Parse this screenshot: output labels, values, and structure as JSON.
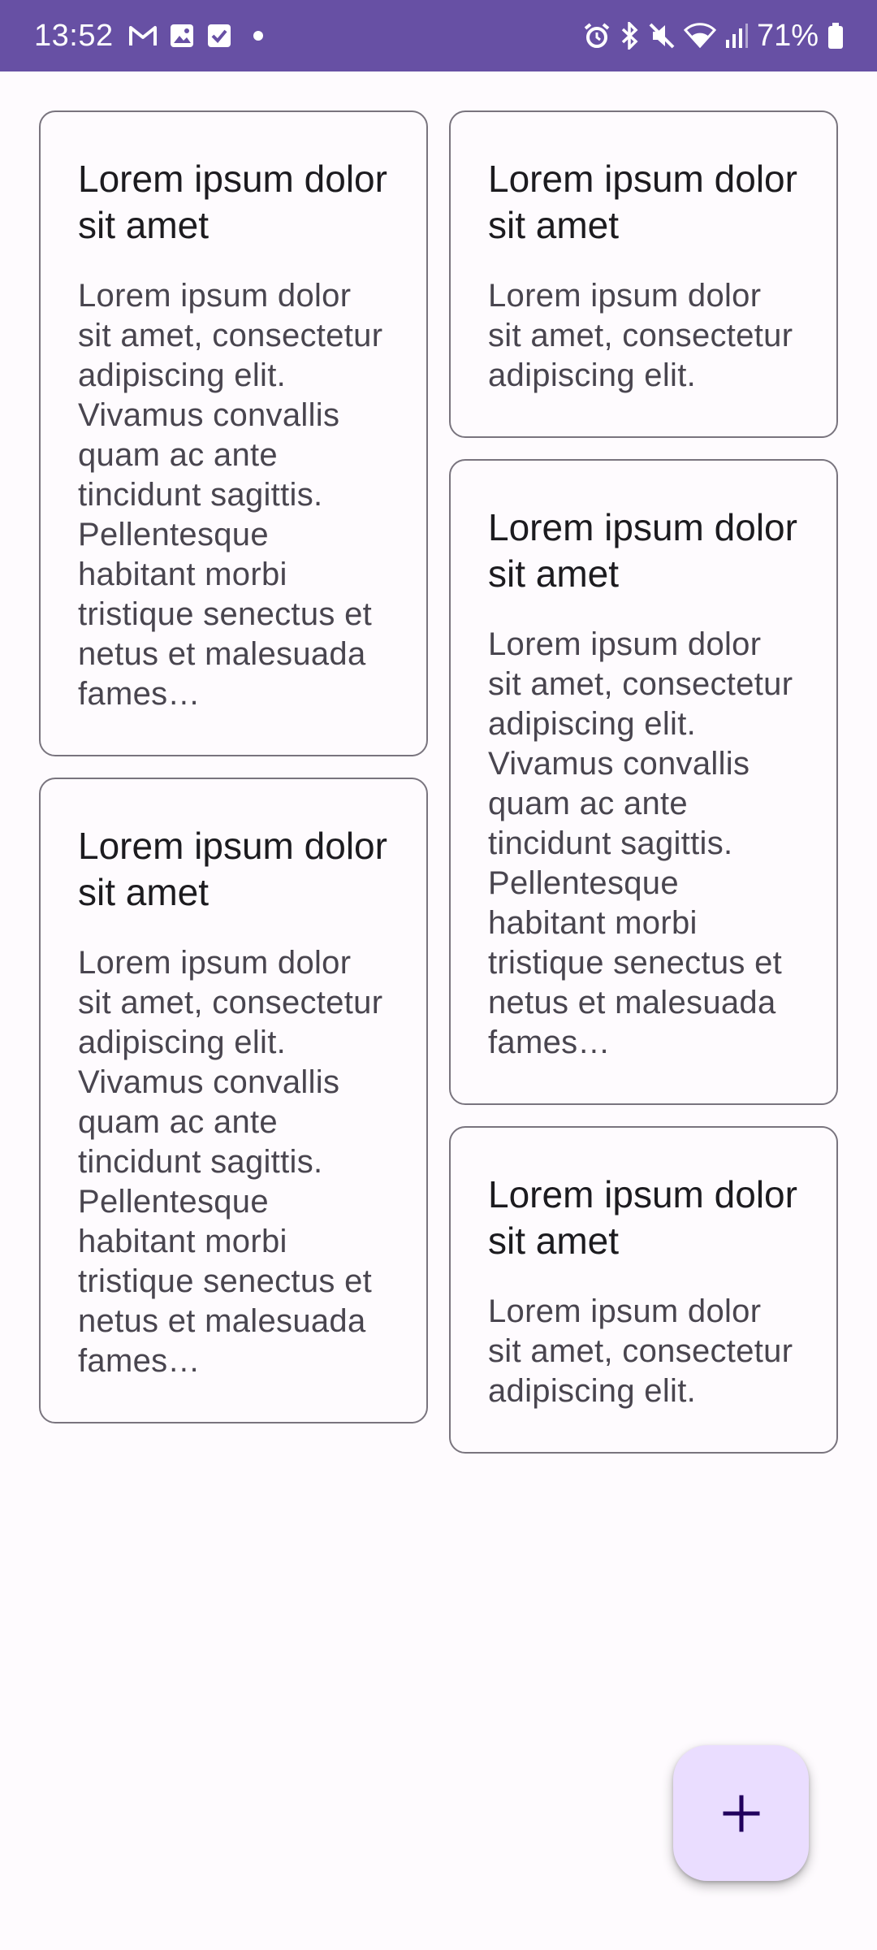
{
  "status_bar": {
    "time": "13:52",
    "battery": "71%",
    "left_icons": [
      "gmail-icon",
      "gallery-icon",
      "checkbox-icon",
      "dot-icon"
    ],
    "right_icons": [
      "alarm-icon",
      "bluetooth-icon",
      "mute-icon",
      "wifi-icon",
      "signal-icon",
      "battery-icon"
    ],
    "background_color": "#6750a4"
  },
  "notes": {
    "left_column": [
      {
        "title": "Lorem ipsum dolor sit amet",
        "body": "Lorem ipsum dolor sit amet, consectetur adipiscing elit. Vivamus convallis quam ac ante tincidunt sagittis. Pellentesque habitant morbi tristique senectus et netus et malesuada fames…"
      },
      {
        "title": "Lorem ipsum dolor sit amet",
        "body": "Lorem ipsum dolor sit amet, consectetur adipiscing elit. Vivamus convallis quam ac ante tincidunt sagittis. Pellentesque habitant morbi tristique senectus et netus et malesuada fames…"
      }
    ],
    "right_column": [
      {
        "title": "Lorem ipsum dolor sit amet",
        "body": "Lorem ipsum dolor sit amet, consectetur adipiscing elit."
      },
      {
        "title": "Lorem ipsum dolor sit amet",
        "body": "Lorem ipsum dolor sit amet, consectetur adipiscing elit. Vivamus convallis quam ac ante tincidunt sagittis. Pellentesque habitant morbi tristique senectus et netus et malesuada fames…"
      },
      {
        "title": "Lorem ipsum dolor sit amet",
        "body": "Lorem ipsum dolor sit amet, consectetur adipiscing elit."
      }
    ]
  },
  "fab": {
    "icon": "plus-icon",
    "background_color": "#eaddff",
    "icon_color": "#21005d"
  }
}
